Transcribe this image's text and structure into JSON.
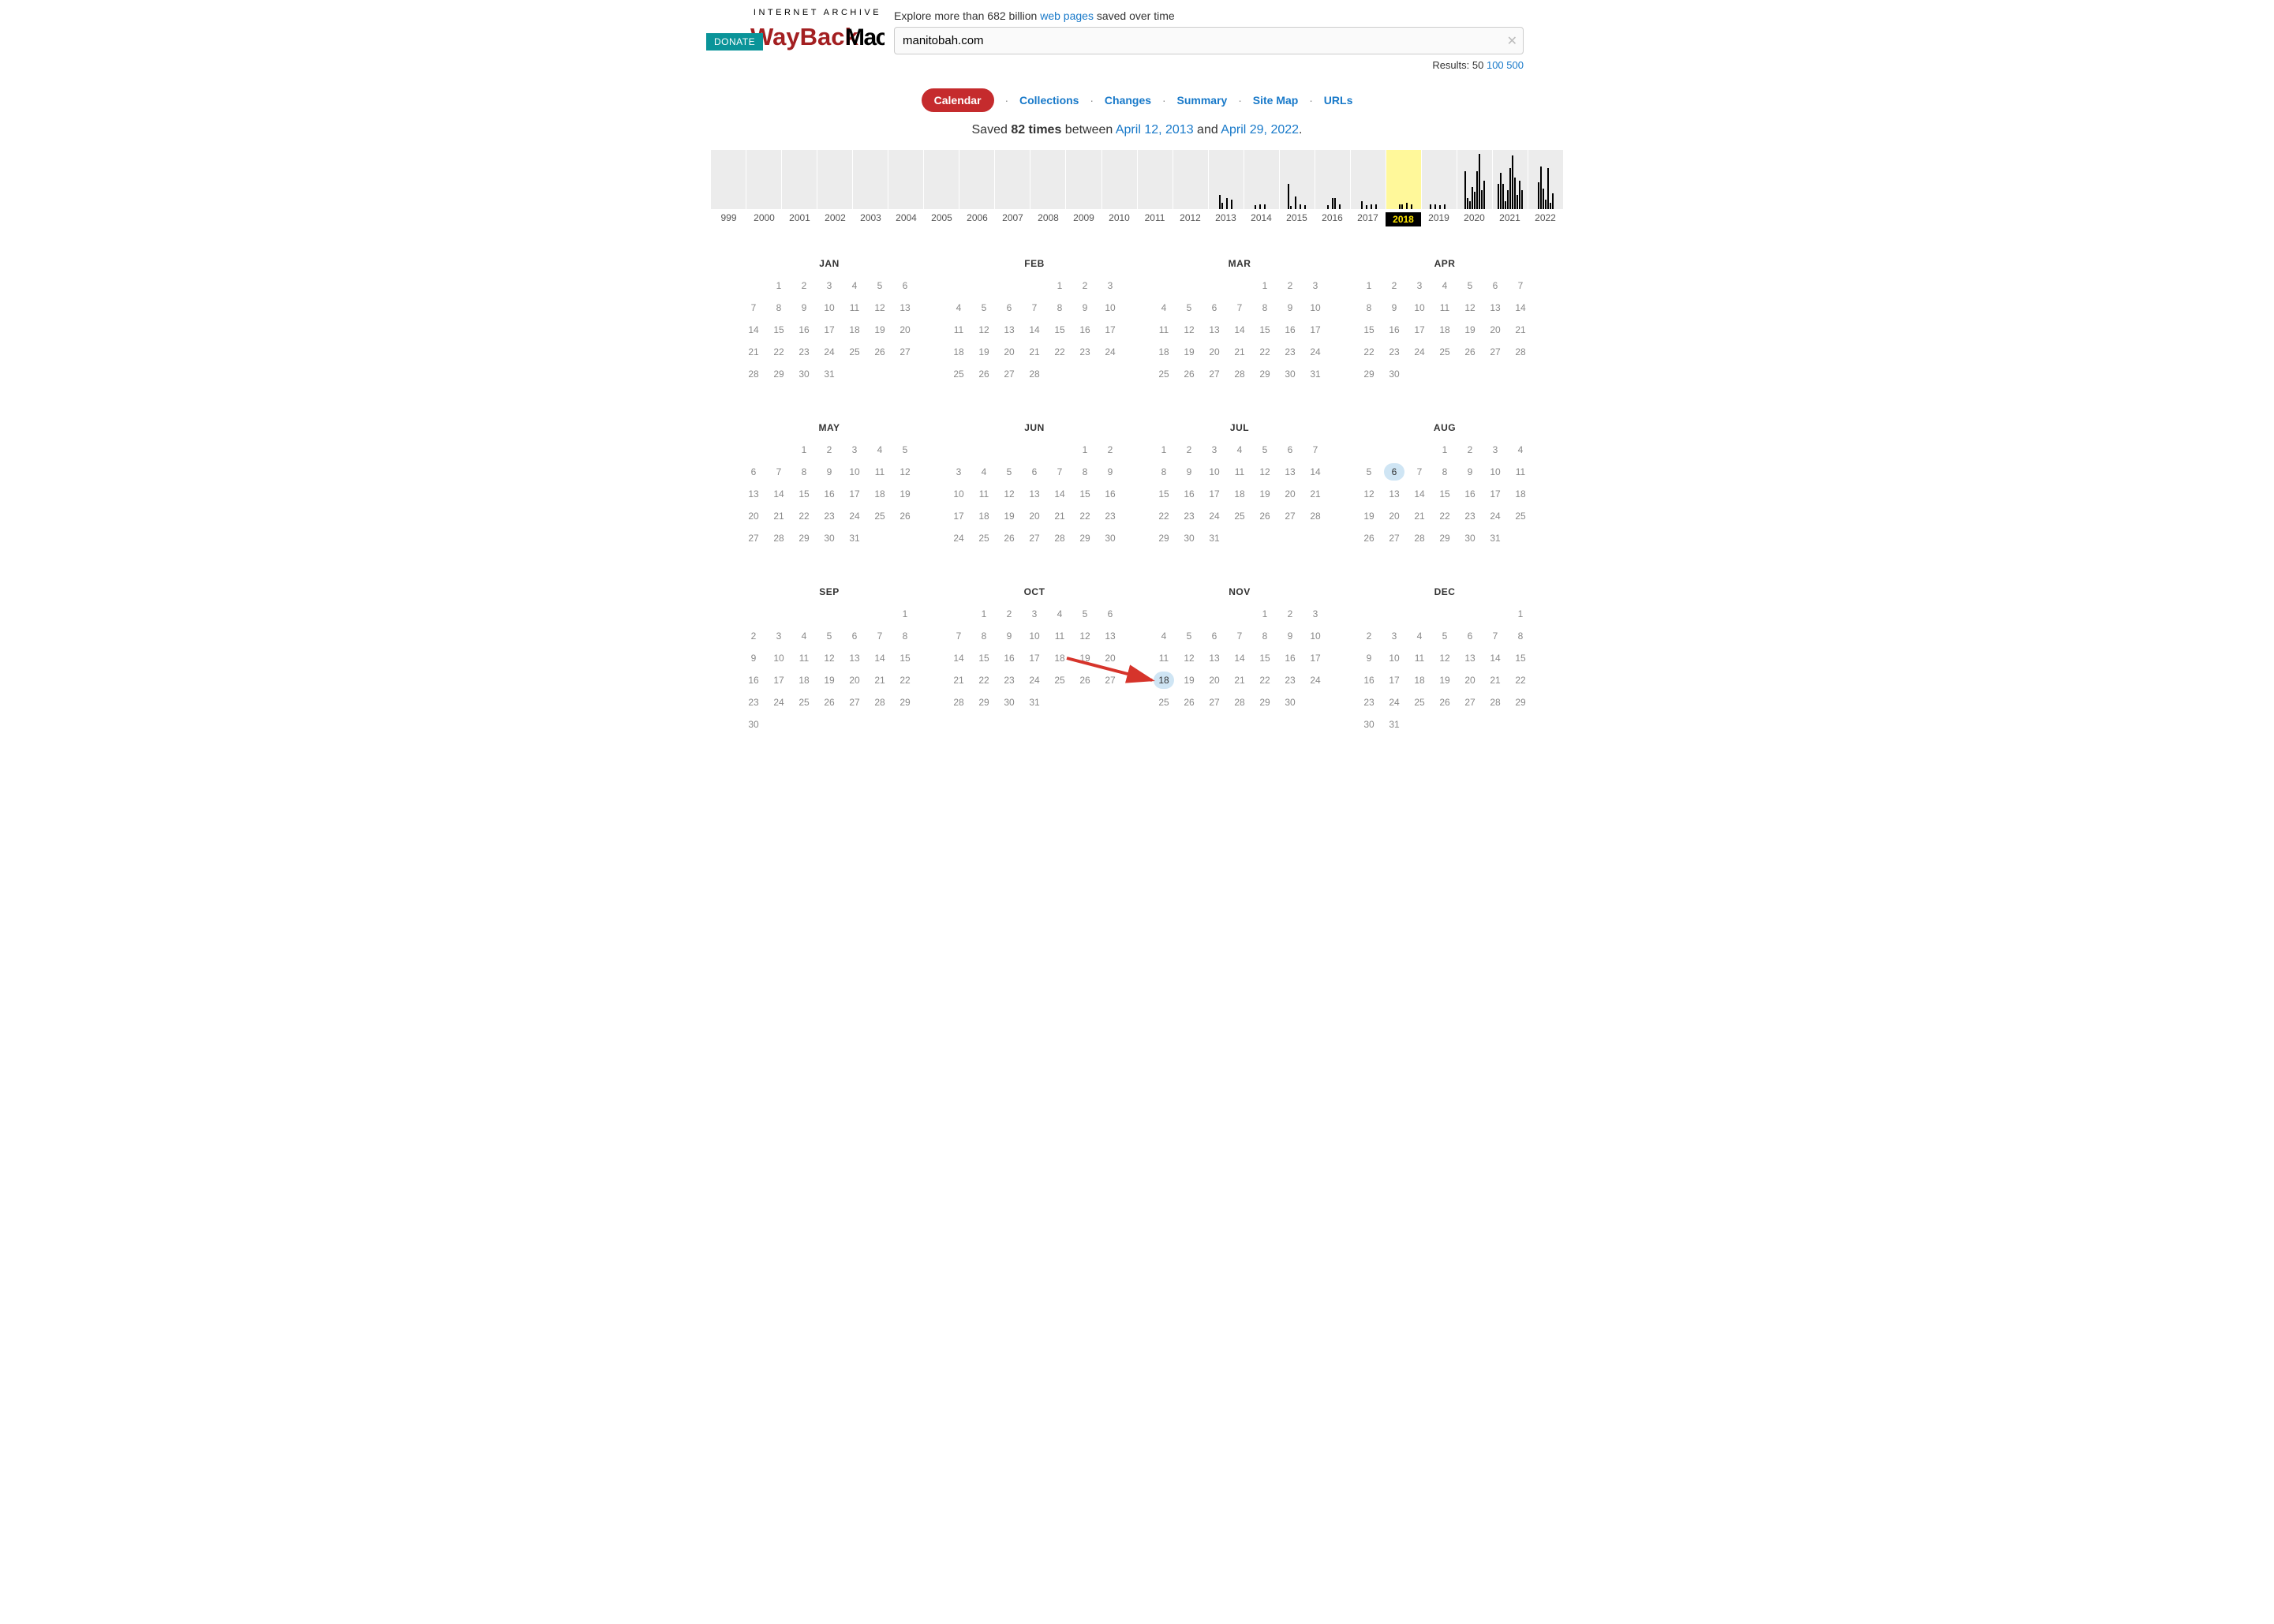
{
  "header": {
    "donate": "DONATE",
    "internet_archive": "INTERNET ARCHIVE",
    "explore_pre": "Explore more than 682 billion ",
    "explore_link": "web pages",
    "explore_post": " saved over time",
    "search_value": "manitobah.com",
    "results_label": "Results: 50 ",
    "results_100": "100",
    "results_500": "500"
  },
  "nav": {
    "calendar": "Calendar",
    "collections": "Collections",
    "changes": "Changes",
    "summary": "Summary",
    "sitemap": "Site Map",
    "urls": "URLs"
  },
  "summary": {
    "saved": "Saved ",
    "count": "82 times",
    "between": " between ",
    "start": "April 12, 2013",
    "and": " and ",
    "end": "April 29, 2022",
    "period": "."
  },
  "sparkline": {
    "selected_year": "2018",
    "years": [
      "999",
      "2000",
      "2001",
      "2002",
      "2003",
      "2004",
      "2005",
      "2006",
      "2007",
      "2008",
      "2009",
      "2010",
      "2011",
      "2012",
      "2013",
      "2014",
      "2015",
      "2016",
      "2017",
      "2018",
      "2019",
      "2020",
      "2021",
      "2022"
    ],
    "bars": {
      "2013": [
        18,
        8,
        0,
        14,
        0,
        12
      ],
      "2014": [
        5,
        0,
        6,
        0,
        6,
        0
      ],
      "2015": [
        32,
        4,
        0,
        16,
        0,
        6,
        0,
        5
      ],
      "2016": [
        0,
        5,
        0,
        14,
        14,
        0,
        6
      ],
      "2017": [
        0,
        10,
        0,
        5,
        0,
        6,
        0,
        6
      ],
      "2018": [
        0,
        0,
        6,
        6,
        0,
        8,
        0,
        6
      ],
      "2019": [
        6,
        0,
        6,
        0,
        5,
        0,
        6,
        0
      ],
      "2020": [
        48,
        14,
        10,
        28,
        22,
        48,
        70,
        24,
        36
      ],
      "2021": [
        32,
        46,
        32,
        10,
        24,
        52,
        68,
        40,
        18,
        36,
        24
      ],
      "2022": [
        34,
        54,
        26,
        12,
        52,
        8,
        20
      ]
    }
  },
  "months": [
    {
      "name": "JAN",
      "start": 1,
      "days": 31
    },
    {
      "name": "FEB",
      "start": 4,
      "days": 28
    },
    {
      "name": "MAR",
      "start": 4,
      "days": 31
    },
    {
      "name": "APR",
      "start": 0,
      "days": 30
    },
    {
      "name": "MAY",
      "start": 2,
      "days": 31
    },
    {
      "name": "JUN",
      "start": 5,
      "days": 30
    },
    {
      "name": "JUL",
      "start": 0,
      "days": 31
    },
    {
      "name": "AUG",
      "start": 3,
      "days": 31,
      "captures": [
        6
      ]
    },
    {
      "name": "SEP",
      "start": 6,
      "days": 30
    },
    {
      "name": "OCT",
      "start": 1,
      "days": 31
    },
    {
      "name": "NOV",
      "start": 4,
      "days": 30,
      "captures": [
        18
      ]
    },
    {
      "name": "DEC",
      "start": 6,
      "days": 31
    }
  ],
  "arrow": {
    "from_month": "OCT",
    "from_day": 18,
    "to_month": "NOV",
    "to_day": 18
  }
}
